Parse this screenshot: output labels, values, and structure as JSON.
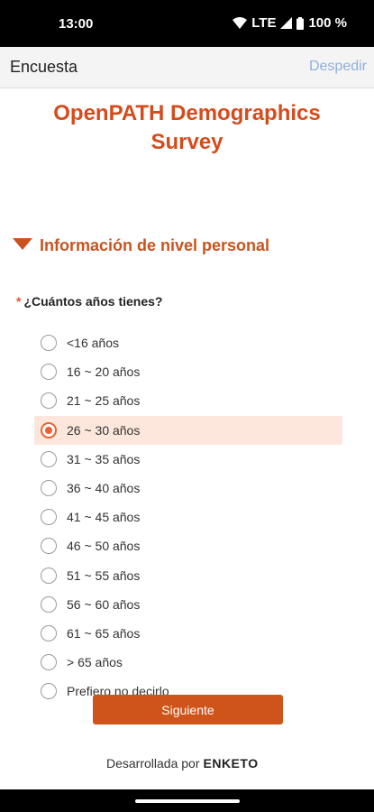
{
  "status": {
    "time": "13:00",
    "network": "LTE",
    "battery": "100 %"
  },
  "topbar": {
    "title": "Encuesta",
    "action": "Despedir"
  },
  "survey": {
    "title_line1": "OpenPATH Demographics",
    "title_line2": "Survey",
    "section_title": "Información de nivel personal",
    "question_required_mark": "*",
    "question": "¿Cuántos años tienes?",
    "options": [
      "<16 años",
      "16 ~ 20 años",
      "21 ~ 25 años",
      "26 ~ 30 años",
      "31 ~ 35 años",
      "36 ~ 40 años",
      "41 ~ 45 años",
      "46 ~ 50 años",
      "51 ~ 55 años",
      "56 ~ 60 años",
      "61 ~ 65 años",
      "> 65 años",
      "Prefiero no decirlo"
    ],
    "selected_option": "26 ~ 30 años",
    "next_label": "Siguiente"
  },
  "footer": {
    "developed_by": "Desarrollada por",
    "brand": "ENKETO"
  },
  "colors": {
    "accent": "#d54c1c",
    "button": "#cf5419",
    "selected_bg": "#fde7dc",
    "link": "#8fb0dc"
  }
}
